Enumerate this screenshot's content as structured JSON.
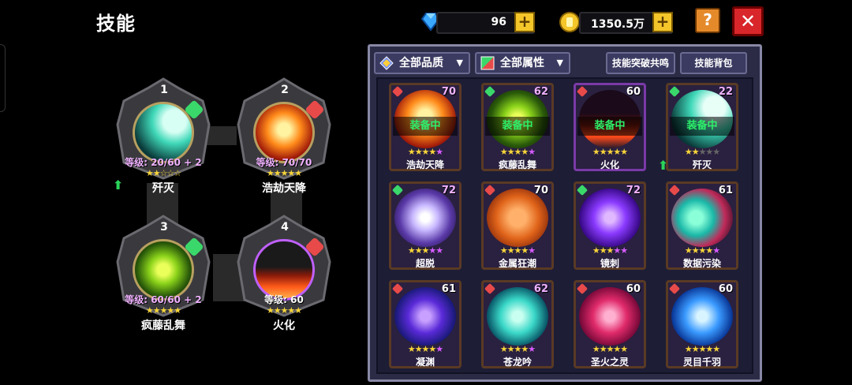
{
  "header": {
    "title": "技能",
    "diamonds": "96",
    "gold": "1350.5万",
    "help": "?",
    "close": "✕"
  },
  "slots": [
    {
      "num": "1",
      "level": "等级: 20/60 + 2",
      "name": "歼灭",
      "element": "green",
      "stars": "★★☆☆☆"
    },
    {
      "num": "2",
      "level": "等级: 70/70",
      "name": "浩劫天降",
      "element": "red",
      "stars": "★★★★★"
    },
    {
      "num": "3",
      "level": "等级: 60/60 + 2",
      "name": "疯藤乱舞",
      "element": "green",
      "stars": "★★★★★"
    },
    {
      "num": "4",
      "level": "等级: 60",
      "name": "火化",
      "element": "red",
      "stars": "★★★★★"
    }
  ],
  "panel": {
    "filter_quality": "全部品质",
    "filter_attr": "全部属性",
    "btn_breakthrough": "技能突破共鸣",
    "btn_bag": "技能背包",
    "equipped_label": "装备中"
  },
  "cards": [
    {
      "name": "浩劫天降",
      "level": "70",
      "equipped": true,
      "element": "red"
    },
    {
      "name": "疯藤乱舞",
      "level": "62",
      "equipped": true,
      "element": "green"
    },
    {
      "name": "火化",
      "level": "60",
      "equipped": true,
      "element": "red"
    },
    {
      "name": "歼灭",
      "level": "22",
      "equipped": true,
      "element": "green"
    },
    {
      "name": "超脱",
      "level": "72",
      "equipped": false,
      "element": "green"
    },
    {
      "name": "金属狂潮",
      "level": "70",
      "equipped": false,
      "element": "red"
    },
    {
      "name": "镜刺",
      "level": "72",
      "equipped": false,
      "element": "green"
    },
    {
      "name": "数据污染",
      "level": "61",
      "equipped": false,
      "element": "red"
    },
    {
      "name": "凝渊",
      "level": "61",
      "equipped": false,
      "element": "red"
    },
    {
      "name": "苍龙吟",
      "level": "62",
      "equipped": false,
      "element": "red"
    },
    {
      "name": "圣火之灵",
      "level": "60",
      "equipped": false,
      "element": "red"
    },
    {
      "name": "灵目千羽",
      "level": "60",
      "equipped": false,
      "element": "red"
    }
  ],
  "colors": {
    "gold": "#f4c62a",
    "close": "#d8262a",
    "help": "#e58a2a",
    "panel": "#2b2b46",
    "equipped_text": "#2df06a",
    "level_pink": "#f0b2ff"
  }
}
